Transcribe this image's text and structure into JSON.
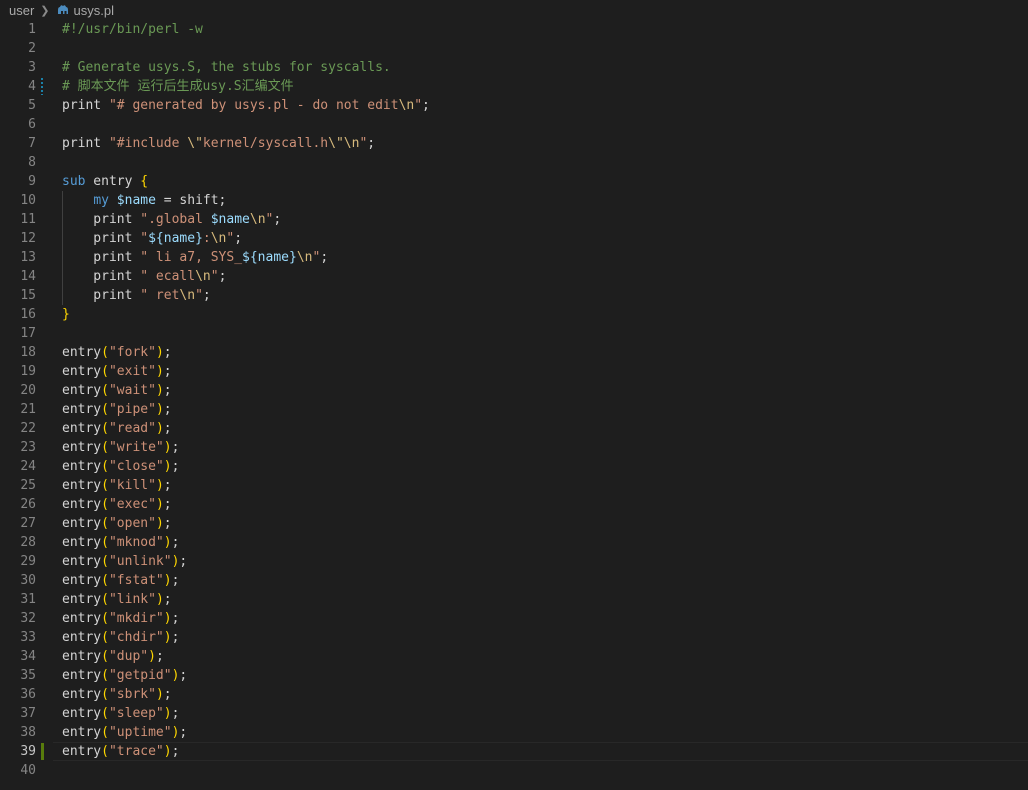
{
  "breadcrumb": {
    "folder": "user",
    "file": "usys.pl",
    "file_icon": "perl-camel-icon"
  },
  "editor": {
    "active_line": 39,
    "lines": [
      {
        "n": "1",
        "tokens": [
          {
            "t": "#!/usr/bin/perl -w",
            "c": "comment"
          }
        ]
      },
      {
        "n": "2",
        "tokens": []
      },
      {
        "n": "3",
        "tokens": [
          {
            "t": "# Generate usys.S, the stubs for syscalls.",
            "c": "comment"
          }
        ]
      },
      {
        "n": "4",
        "mark": "mod",
        "tokens": [
          {
            "t": "# 脚本文件 运行后生成usy.S汇编文件",
            "c": "comment"
          }
        ]
      },
      {
        "n": "5",
        "tokens": [
          {
            "t": "print ",
            "c": "text"
          },
          {
            "t": "\"# generated by usys.pl - do not edit",
            "c": "str"
          },
          {
            "t": "\\n",
            "c": "esc"
          },
          {
            "t": "\"",
            "c": "str"
          },
          {
            "t": ";",
            "c": "text"
          }
        ]
      },
      {
        "n": "6",
        "tokens": []
      },
      {
        "n": "7",
        "tokens": [
          {
            "t": "print ",
            "c": "text"
          },
          {
            "t": "\"#include ",
            "c": "str"
          },
          {
            "t": "\\\"",
            "c": "esc"
          },
          {
            "t": "kernel/syscall.h",
            "c": "str"
          },
          {
            "t": "\\\"\\n",
            "c": "esc"
          },
          {
            "t": "\"",
            "c": "str"
          },
          {
            "t": ";",
            "c": "text"
          }
        ]
      },
      {
        "n": "8",
        "tokens": []
      },
      {
        "n": "9",
        "tokens": [
          {
            "t": "sub",
            "c": "kw"
          },
          {
            "t": " entry ",
            "c": "text"
          },
          {
            "t": "{",
            "c": "punc"
          }
        ]
      },
      {
        "n": "10",
        "guide": true,
        "tokens": [
          {
            "t": "    ",
            "c": "text"
          },
          {
            "t": "my",
            "c": "kw"
          },
          {
            "t": " ",
            "c": "text"
          },
          {
            "t": "$name",
            "c": "var"
          },
          {
            "t": " = shift;",
            "c": "text"
          }
        ]
      },
      {
        "n": "11",
        "guide": true,
        "tokens": [
          {
            "t": "    print ",
            "c": "text"
          },
          {
            "t": "\".global ",
            "c": "str"
          },
          {
            "t": "$name",
            "c": "var"
          },
          {
            "t": "\\n",
            "c": "esc"
          },
          {
            "t": "\"",
            "c": "str"
          },
          {
            "t": ";",
            "c": "text"
          }
        ]
      },
      {
        "n": "12",
        "guide": true,
        "tokens": [
          {
            "t": "    print ",
            "c": "text"
          },
          {
            "t": "\"",
            "c": "str"
          },
          {
            "t": "${name}",
            "c": "var"
          },
          {
            "t": ":",
            "c": "str"
          },
          {
            "t": "\\n",
            "c": "esc"
          },
          {
            "t": "\"",
            "c": "str"
          },
          {
            "t": ";",
            "c": "text"
          }
        ]
      },
      {
        "n": "13",
        "guide": true,
        "tokens": [
          {
            "t": "    print ",
            "c": "text"
          },
          {
            "t": "\" li a7, SYS_",
            "c": "str"
          },
          {
            "t": "${name}",
            "c": "var"
          },
          {
            "t": "\\n",
            "c": "esc"
          },
          {
            "t": "\"",
            "c": "str"
          },
          {
            "t": ";",
            "c": "text"
          }
        ]
      },
      {
        "n": "14",
        "guide": true,
        "tokens": [
          {
            "t": "    print ",
            "c": "text"
          },
          {
            "t": "\" ecall",
            "c": "str"
          },
          {
            "t": "\\n",
            "c": "esc"
          },
          {
            "t": "\"",
            "c": "str"
          },
          {
            "t": ";",
            "c": "text"
          }
        ]
      },
      {
        "n": "15",
        "guide": true,
        "tokens": [
          {
            "t": "    print ",
            "c": "text"
          },
          {
            "t": "\" ret",
            "c": "str"
          },
          {
            "t": "\\n",
            "c": "esc"
          },
          {
            "t": "\"",
            "c": "str"
          },
          {
            "t": ";",
            "c": "text"
          }
        ]
      },
      {
        "n": "16",
        "tokens": [
          {
            "t": "}",
            "c": "punc"
          }
        ]
      },
      {
        "n": "17",
        "tokens": []
      },
      {
        "n": "18",
        "tokens": [
          {
            "t": "entry",
            "c": "text"
          },
          {
            "t": "(",
            "c": "punc"
          },
          {
            "t": "\"fork\"",
            "c": "str"
          },
          {
            "t": ")",
            "c": "punc"
          },
          {
            "t": ";",
            "c": "text"
          }
        ]
      },
      {
        "n": "19",
        "tokens": [
          {
            "t": "entry",
            "c": "text"
          },
          {
            "t": "(",
            "c": "punc"
          },
          {
            "t": "\"exit\"",
            "c": "str"
          },
          {
            "t": ")",
            "c": "punc"
          },
          {
            "t": ";",
            "c": "text"
          }
        ]
      },
      {
        "n": "20",
        "tokens": [
          {
            "t": "entry",
            "c": "text"
          },
          {
            "t": "(",
            "c": "punc"
          },
          {
            "t": "\"wait\"",
            "c": "str"
          },
          {
            "t": ")",
            "c": "punc"
          },
          {
            "t": ";",
            "c": "text"
          }
        ]
      },
      {
        "n": "21",
        "tokens": [
          {
            "t": "entry",
            "c": "text"
          },
          {
            "t": "(",
            "c": "punc"
          },
          {
            "t": "\"pipe\"",
            "c": "str"
          },
          {
            "t": ")",
            "c": "punc"
          },
          {
            "t": ";",
            "c": "text"
          }
        ]
      },
      {
        "n": "22",
        "tokens": [
          {
            "t": "entry",
            "c": "text"
          },
          {
            "t": "(",
            "c": "punc"
          },
          {
            "t": "\"read\"",
            "c": "str"
          },
          {
            "t": ")",
            "c": "punc"
          },
          {
            "t": ";",
            "c": "text"
          }
        ]
      },
      {
        "n": "23",
        "tokens": [
          {
            "t": "entry",
            "c": "text"
          },
          {
            "t": "(",
            "c": "punc"
          },
          {
            "t": "\"write\"",
            "c": "str"
          },
          {
            "t": ")",
            "c": "punc"
          },
          {
            "t": ";",
            "c": "text"
          }
        ]
      },
      {
        "n": "24",
        "tokens": [
          {
            "t": "entry",
            "c": "text"
          },
          {
            "t": "(",
            "c": "punc"
          },
          {
            "t": "\"close\"",
            "c": "str"
          },
          {
            "t": ")",
            "c": "punc"
          },
          {
            "t": ";",
            "c": "text"
          }
        ]
      },
      {
        "n": "25",
        "tokens": [
          {
            "t": "entry",
            "c": "text"
          },
          {
            "t": "(",
            "c": "punc"
          },
          {
            "t": "\"kill\"",
            "c": "str"
          },
          {
            "t": ")",
            "c": "punc"
          },
          {
            "t": ";",
            "c": "text"
          }
        ]
      },
      {
        "n": "26",
        "tokens": [
          {
            "t": "entry",
            "c": "text"
          },
          {
            "t": "(",
            "c": "punc"
          },
          {
            "t": "\"exec\"",
            "c": "str"
          },
          {
            "t": ")",
            "c": "punc"
          },
          {
            "t": ";",
            "c": "text"
          }
        ]
      },
      {
        "n": "27",
        "tokens": [
          {
            "t": "entry",
            "c": "text"
          },
          {
            "t": "(",
            "c": "punc"
          },
          {
            "t": "\"open\"",
            "c": "str"
          },
          {
            "t": ")",
            "c": "punc"
          },
          {
            "t": ";",
            "c": "text"
          }
        ]
      },
      {
        "n": "28",
        "tokens": [
          {
            "t": "entry",
            "c": "text"
          },
          {
            "t": "(",
            "c": "punc"
          },
          {
            "t": "\"mknod\"",
            "c": "str"
          },
          {
            "t": ")",
            "c": "punc"
          },
          {
            "t": ";",
            "c": "text"
          }
        ]
      },
      {
        "n": "29",
        "tokens": [
          {
            "t": "entry",
            "c": "text"
          },
          {
            "t": "(",
            "c": "punc"
          },
          {
            "t": "\"unlink\"",
            "c": "str"
          },
          {
            "t": ")",
            "c": "punc"
          },
          {
            "t": ";",
            "c": "text"
          }
        ]
      },
      {
        "n": "30",
        "tokens": [
          {
            "t": "entry",
            "c": "text"
          },
          {
            "t": "(",
            "c": "punc"
          },
          {
            "t": "\"fstat\"",
            "c": "str"
          },
          {
            "t": ")",
            "c": "punc"
          },
          {
            "t": ";",
            "c": "text"
          }
        ]
      },
      {
        "n": "31",
        "tokens": [
          {
            "t": "entry",
            "c": "text"
          },
          {
            "t": "(",
            "c": "punc"
          },
          {
            "t": "\"link\"",
            "c": "str"
          },
          {
            "t": ")",
            "c": "punc"
          },
          {
            "t": ";",
            "c": "text"
          }
        ]
      },
      {
        "n": "32",
        "tokens": [
          {
            "t": "entry",
            "c": "text"
          },
          {
            "t": "(",
            "c": "punc"
          },
          {
            "t": "\"mkdir\"",
            "c": "str"
          },
          {
            "t": ")",
            "c": "punc"
          },
          {
            "t": ";",
            "c": "text"
          }
        ]
      },
      {
        "n": "33",
        "tokens": [
          {
            "t": "entry",
            "c": "text"
          },
          {
            "t": "(",
            "c": "punc"
          },
          {
            "t": "\"chdir\"",
            "c": "str"
          },
          {
            "t": ")",
            "c": "punc"
          },
          {
            "t": ";",
            "c": "text"
          }
        ]
      },
      {
        "n": "34",
        "tokens": [
          {
            "t": "entry",
            "c": "text"
          },
          {
            "t": "(",
            "c": "punc"
          },
          {
            "t": "\"dup\"",
            "c": "str"
          },
          {
            "t": ")",
            "c": "punc"
          },
          {
            "t": ";",
            "c": "text"
          }
        ]
      },
      {
        "n": "35",
        "tokens": [
          {
            "t": "entry",
            "c": "text"
          },
          {
            "t": "(",
            "c": "punc"
          },
          {
            "t": "\"getpid\"",
            "c": "str"
          },
          {
            "t": ")",
            "c": "punc"
          },
          {
            "t": ";",
            "c": "text"
          }
        ]
      },
      {
        "n": "36",
        "tokens": [
          {
            "t": "entry",
            "c": "text"
          },
          {
            "t": "(",
            "c": "punc"
          },
          {
            "t": "\"sbrk\"",
            "c": "str"
          },
          {
            "t": ")",
            "c": "punc"
          },
          {
            "t": ";",
            "c": "text"
          }
        ]
      },
      {
        "n": "37",
        "tokens": [
          {
            "t": "entry",
            "c": "text"
          },
          {
            "t": "(",
            "c": "punc"
          },
          {
            "t": "\"sleep\"",
            "c": "str"
          },
          {
            "t": ")",
            "c": "punc"
          },
          {
            "t": ";",
            "c": "text"
          }
        ]
      },
      {
        "n": "38",
        "tokens": [
          {
            "t": "entry",
            "c": "text"
          },
          {
            "t": "(",
            "c": "punc"
          },
          {
            "t": "\"uptime\"",
            "c": "str"
          },
          {
            "t": ")",
            "c": "punc"
          },
          {
            "t": ";",
            "c": "text"
          }
        ]
      },
      {
        "n": "39",
        "mark": "add",
        "tokens": [
          {
            "t": "entry",
            "c": "text"
          },
          {
            "t": "(",
            "c": "punc"
          },
          {
            "t": "\"trace\"",
            "c": "str"
          },
          {
            "t": ")",
            "c": "punc"
          },
          {
            "t": ";",
            "c": "text"
          }
        ]
      },
      {
        "n": "40",
        "tokens": []
      }
    ]
  }
}
